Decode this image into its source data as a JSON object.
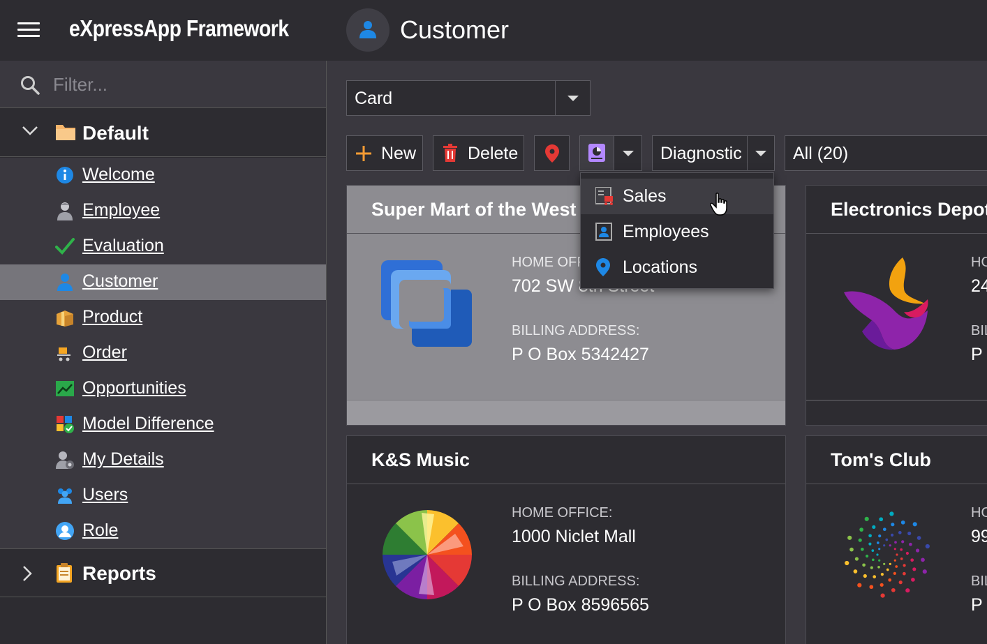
{
  "header": {
    "app_title": "eXpressApp Framework",
    "view_title": "Customer",
    "view_icon": "customer-icon"
  },
  "sidebar": {
    "filter_placeholder": "Filter...",
    "groups": [
      {
        "label": "Default",
        "icon": "folder-icon",
        "expanded": true
      },
      {
        "label": "Reports",
        "icon": "clipboard-icon",
        "expanded": false
      }
    ],
    "items": [
      {
        "label": "Welcome",
        "icon": "info-icon"
      },
      {
        "label": "Employee",
        "icon": "employee-icon"
      },
      {
        "label": "Evaluation",
        "icon": "checkmark-icon"
      },
      {
        "label": "Customer",
        "icon": "customer-icon",
        "active": true
      },
      {
        "label": "Product",
        "icon": "product-box-icon"
      },
      {
        "label": "Order",
        "icon": "order-cart-icon"
      },
      {
        "label": "Opportunities",
        "icon": "chart-up-icon"
      },
      {
        "label": "Model Difference",
        "icon": "model-difference-icon"
      },
      {
        "label": "My Details",
        "icon": "user-settings-icon"
      },
      {
        "label": "Users",
        "icon": "users-icon"
      },
      {
        "label": "Role",
        "icon": "role-icon"
      }
    ]
  },
  "toolbar": {
    "view_variant": "Card",
    "new_label": "New",
    "delete_label": "Delete",
    "diagnostic_label": "Diagnostic",
    "filter_label": "All (20)"
  },
  "report_menu": {
    "items": [
      {
        "label": "Sales",
        "icon": "sales-report-icon"
      },
      {
        "label": "Employees",
        "icon": "employees-report-icon"
      },
      {
        "label": "Locations",
        "icon": "location-pin-icon"
      }
    ]
  },
  "cards": [
    {
      "title": "Super Mart of the West",
      "home_office_label": "HOME OFFICE:",
      "home_office": "702 SW 8th Street",
      "billing_label": "BILLING ADDRESS:",
      "billing": "P O Box 5342427"
    },
    {
      "title": "Electronics Depot",
      "home_office_label": "HO",
      "home_office": "24",
      "billing_label": "BIL",
      "billing": "P ("
    },
    {
      "title": "K&S Music",
      "home_office_label": "HOME OFFICE:",
      "home_office": "1000 Niclet Mall",
      "billing_label": "BILLING ADDRESS:",
      "billing": "P O Box 8596565"
    },
    {
      "title": "Tom's Club",
      "home_office_label": "HO",
      "home_office": "99",
      "billing_label": "BIL",
      "billing": "P ("
    }
  ]
}
